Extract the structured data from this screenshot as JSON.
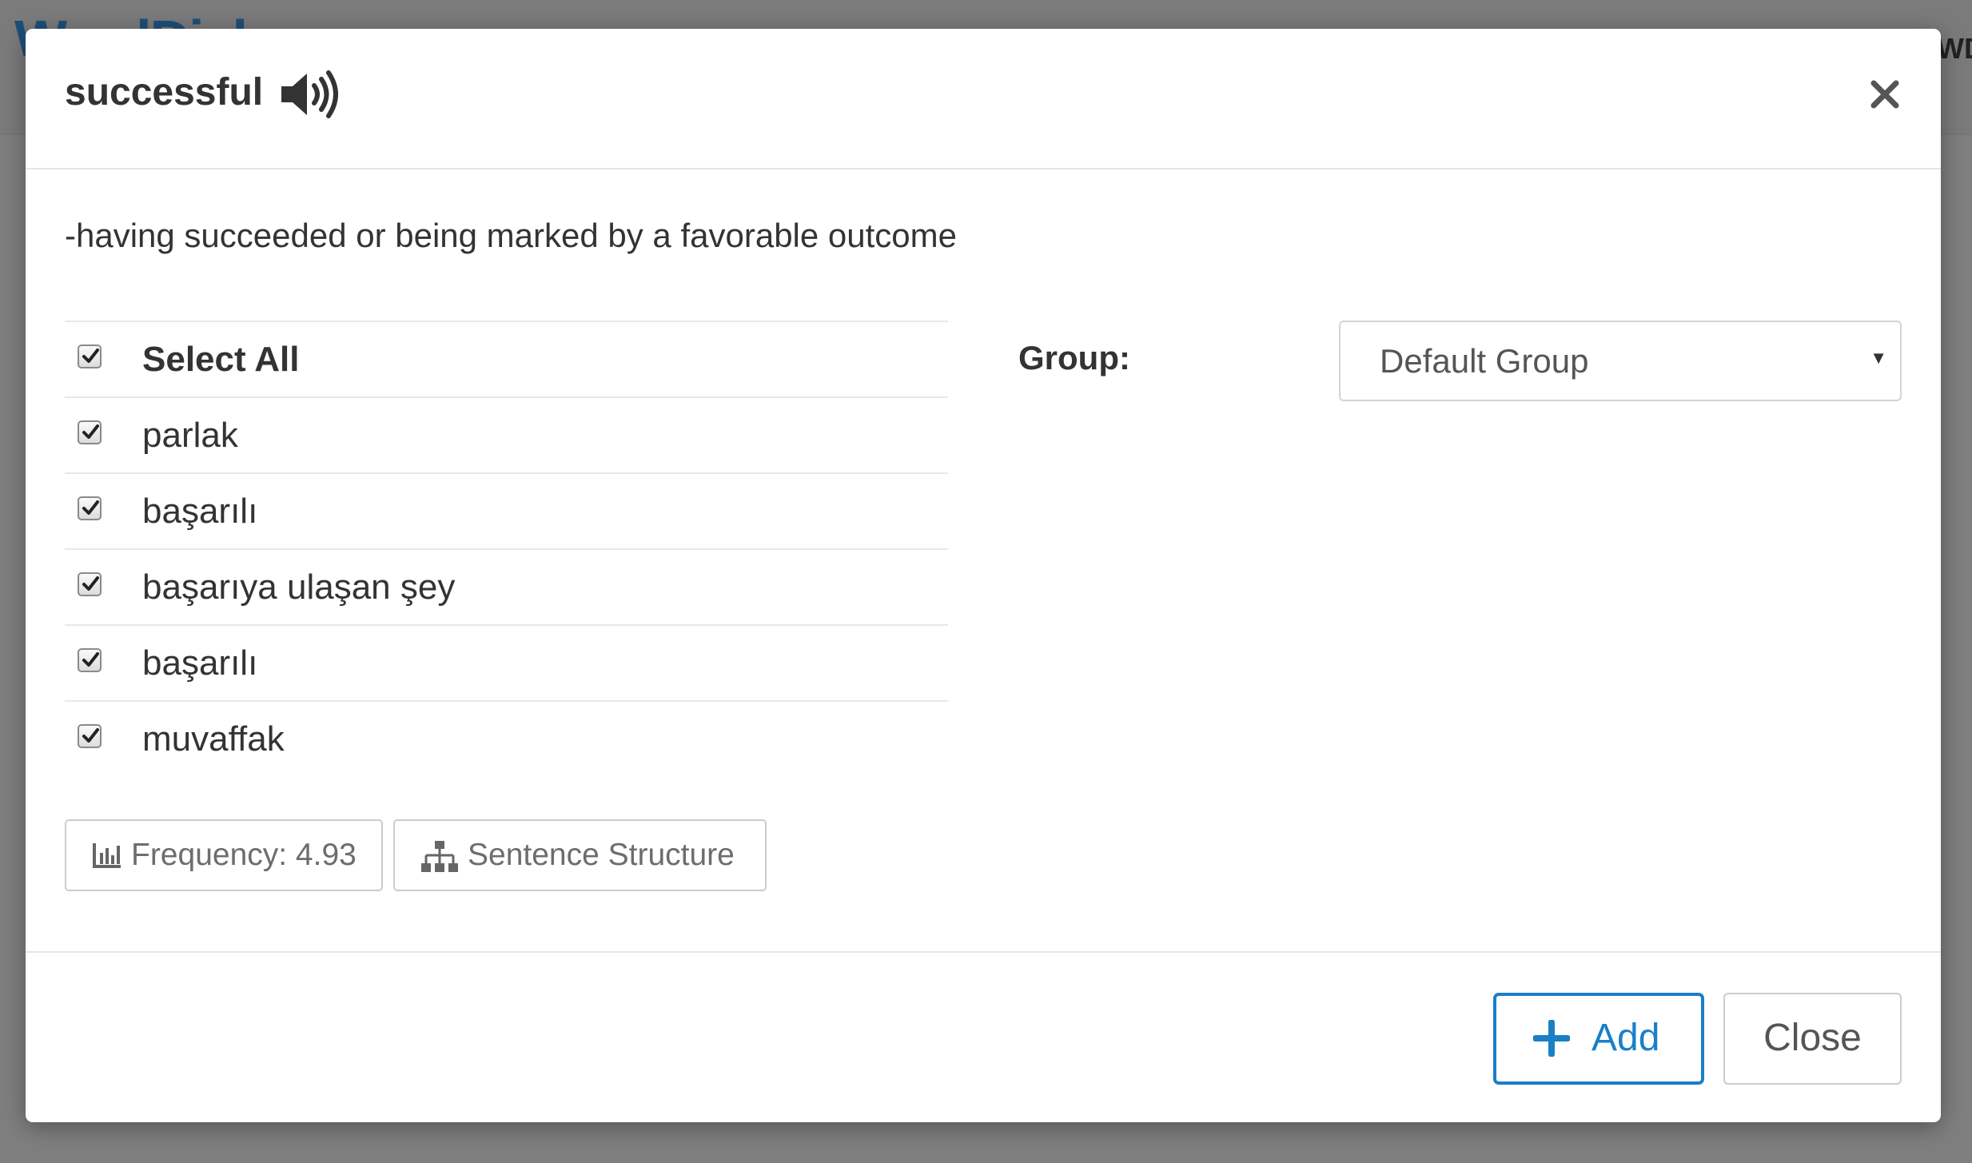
{
  "background": {
    "logo_text": "WordDick",
    "right_text": "WD"
  },
  "modal": {
    "title": "successful",
    "definition": "-having succeeded or being marked by a favorable outcome",
    "translations": [
      {
        "label": "Select All",
        "checked": true
      },
      {
        "label": "parlak",
        "checked": true
      },
      {
        "label": "başarılı",
        "checked": true
      },
      {
        "label": "başarıya ulaşan şey",
        "checked": true
      },
      {
        "label": "başarılı",
        "checked": true
      },
      {
        "label": "muvaffak",
        "checked": true
      }
    ],
    "frequency_button": "Frequency: 4.93",
    "sentence_button": "Sentence Structure",
    "group": {
      "label": "Group:",
      "selected": "Default Group"
    },
    "footer": {
      "add_label": "Add",
      "close_label": "Close"
    }
  },
  "colors": {
    "accent": "#1a7fc8",
    "overlay": "#7f7f7f",
    "text": "#333333"
  },
  "icons": {
    "audio": "speaker-icon",
    "close": "close-icon",
    "frequency": "bar-chart-icon",
    "sentence": "sitemap-icon",
    "add": "plus-icon",
    "dropdown": "caret-down-icon",
    "checkbox": "checkmark-icon"
  }
}
